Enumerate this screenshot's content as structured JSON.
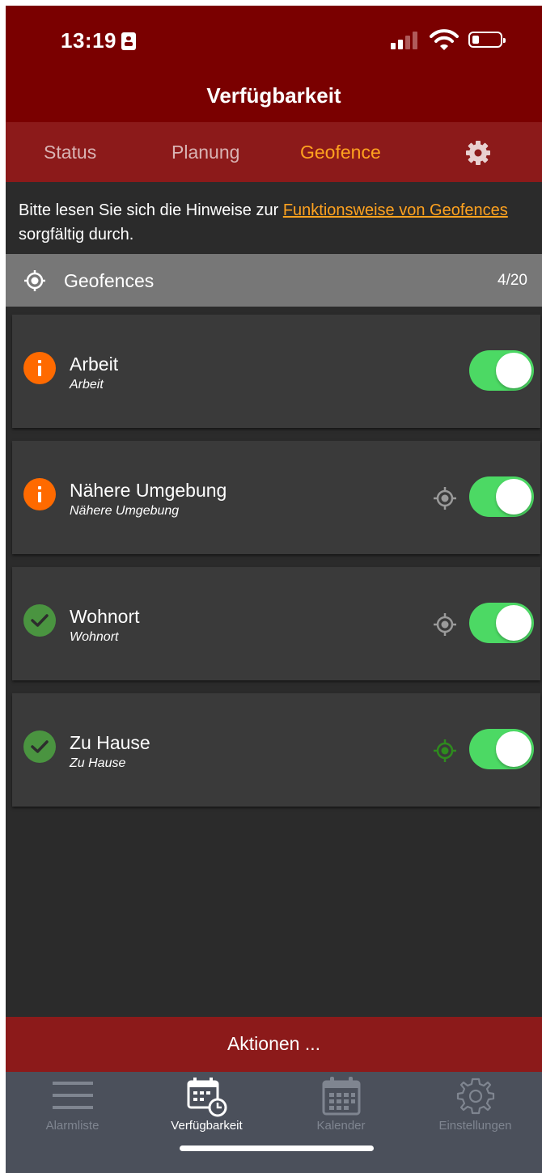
{
  "status_bar": {
    "time": "13:19"
  },
  "header": {
    "title": "Verfügbarkeit"
  },
  "tabs": [
    {
      "label": "Status",
      "active": false
    },
    {
      "label": "Planung",
      "active": false
    },
    {
      "label": "Geofence",
      "active": true
    }
  ],
  "notice": {
    "text_before": "Bitte lesen Sie sich die Hinweise zur ",
    "link": "Funktionsweise von Geofences",
    "text_after": " sorgfältig durch."
  },
  "section": {
    "title": "Geofences",
    "count": "4/20"
  },
  "geofences": [
    {
      "title": "Arbeit",
      "subtitle": "Arbeit",
      "status": "warning",
      "enabled": true,
      "location_icon": "none"
    },
    {
      "title": "Nähere Umgebung",
      "subtitle": "Nähere Umgebung",
      "status": "warning",
      "enabled": true,
      "location_icon": "gray"
    },
    {
      "title": "Wohnort",
      "subtitle": "Wohnort",
      "status": "ok",
      "enabled": true,
      "location_icon": "gray"
    },
    {
      "title": "Zu Hause",
      "subtitle": "Zu Hause",
      "status": "ok",
      "enabled": true,
      "location_icon": "green"
    }
  ],
  "actions": {
    "label": "Aktionen ..."
  },
  "bottom_nav": [
    {
      "label": "Alarmliste",
      "icon": "list-icon",
      "active": false
    },
    {
      "label": "Verfügbarkeit",
      "icon": "calendar-clock-icon",
      "active": true
    },
    {
      "label": "Kalender",
      "icon": "calendar-icon",
      "active": false
    },
    {
      "label": "Einstellungen",
      "icon": "gear-icon",
      "active": false
    }
  ],
  "colors": {
    "header": "#7a0000",
    "tabs": "#8c1a1a",
    "accent": "#ffa21f",
    "toggle_on": "#4cd964",
    "warning": "#ff6a00",
    "ok": "#4a9440",
    "location_active": "#2e8b1e"
  }
}
